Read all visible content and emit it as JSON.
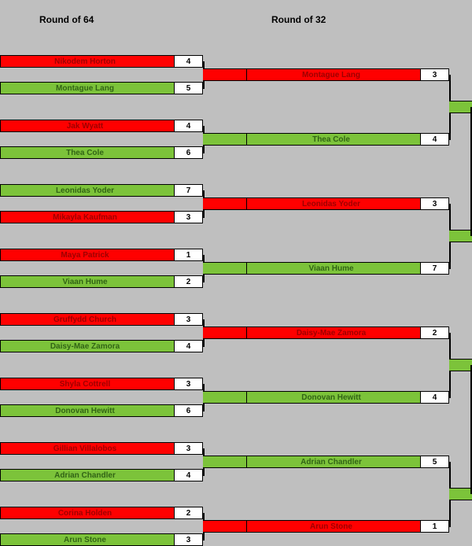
{
  "rounds": [
    {
      "title": "Round of 64"
    },
    {
      "title": "Round of 32"
    }
  ],
  "r64": [
    {
      "players": [
        {
          "name": "Nikodem Horton",
          "score": 4,
          "winner": false
        },
        {
          "name": "Montague Lang",
          "score": 5,
          "winner": true
        }
      ]
    },
    {
      "players": [
        {
          "name": "Jak Wyatt",
          "score": 4,
          "winner": false
        },
        {
          "name": "Thea Cole",
          "score": 6,
          "winner": true
        }
      ]
    },
    {
      "players": [
        {
          "name": "Leonidas Yoder",
          "score": 7,
          "winner": true
        },
        {
          "name": "Mikayla Kaufman",
          "score": 3,
          "winner": false
        }
      ]
    },
    {
      "players": [
        {
          "name": "Maya Patrick",
          "score": 1,
          "winner": false
        },
        {
          "name": "Viaan Hume",
          "score": 2,
          "winner": true
        }
      ]
    },
    {
      "players": [
        {
          "name": "Gruffydd Church",
          "score": 3,
          "winner": false
        },
        {
          "name": "Daisy-Mae Zamora",
          "score": 4,
          "winner": true
        }
      ]
    },
    {
      "players": [
        {
          "name": "Shyla Cottrell",
          "score": 3,
          "winner": false
        },
        {
          "name": "Donovan Hewitt",
          "score": 6,
          "winner": true
        }
      ]
    },
    {
      "players": [
        {
          "name": "Gillian Villalobos",
          "score": 3,
          "winner": false
        },
        {
          "name": "Adrian Chandler",
          "score": 4,
          "winner": true
        }
      ]
    },
    {
      "players": [
        {
          "name": "Corina Holden",
          "score": 2,
          "winner": false
        },
        {
          "name": "Arun Stone",
          "score": 3,
          "winner": true
        }
      ]
    }
  ],
  "r32": [
    {
      "players": [
        {
          "name": "Montague Lang",
          "score": 3,
          "winner": false
        },
        {
          "name": "Thea Cole",
          "score": 4,
          "winner": true
        }
      ]
    },
    {
      "players": [
        {
          "name": "Leonidas Yoder",
          "score": 3,
          "winner": false
        },
        {
          "name": "Viaan Hume",
          "score": 7,
          "winner": true
        }
      ]
    },
    {
      "players": [
        {
          "name": "Daisy-Mae Zamora",
          "score": 2,
          "winner": false
        },
        {
          "name": "Donovan Hewitt",
          "score": 4,
          "winner": true
        }
      ]
    },
    {
      "players": [
        {
          "name": "Adrian Chandler",
          "score": 5,
          "winner": true
        },
        {
          "name": "Arun Stone",
          "score": 1,
          "winner": false
        }
      ]
    }
  ]
}
